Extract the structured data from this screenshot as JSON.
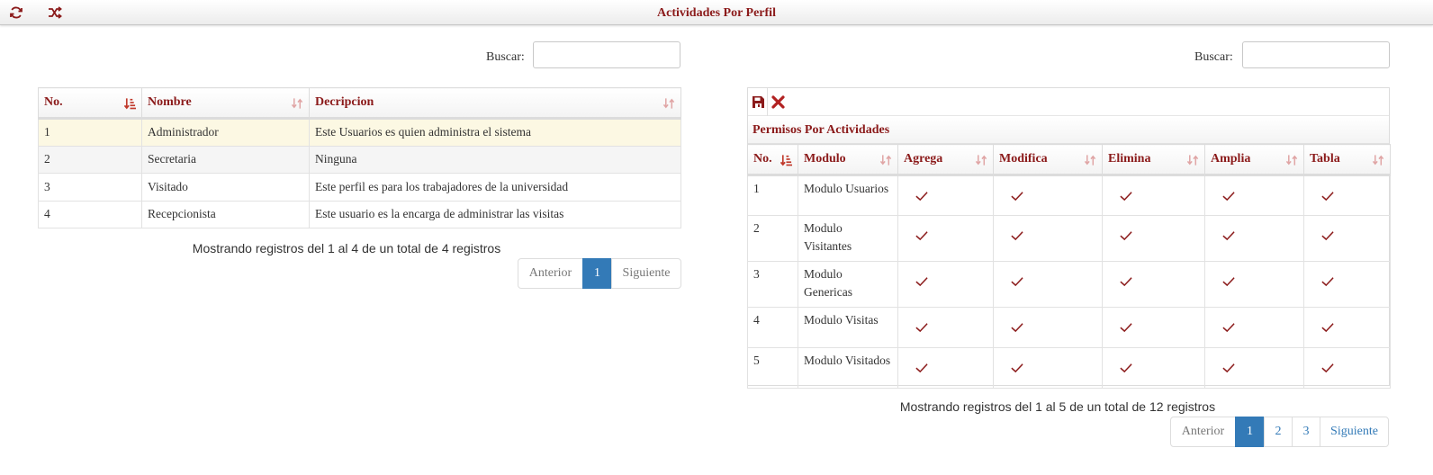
{
  "header": {
    "title": "Actividades Por Perfil",
    "refresh_icon": "refresh-icon",
    "shuffle_icon": "shuffle-icon"
  },
  "colors": {
    "accent": "#8b1a1a",
    "highlight_row": "#fcf8e3",
    "primary": "#337ab7"
  },
  "left": {
    "search_label": "Buscar:",
    "search_value": "",
    "columns": [
      "No.",
      "Nombre",
      "Decripcion"
    ],
    "rows": [
      {
        "no": "1",
        "nombre": "Administrador",
        "descripcion": "Este Usuarios es quien administra el sistema"
      },
      {
        "no": "2",
        "nombre": "Secretaria",
        "descripcion": "Ninguna"
      },
      {
        "no": "3",
        "nombre": "Visitado",
        "descripcion": "Este perfil es para los trabajadores de la universidad"
      },
      {
        "no": "4",
        "nombre": "Recepcionista",
        "descripcion": "Este usuario es la encarga de administrar las visitas"
      }
    ],
    "info": "Mostrando registros del 1 al 4 de un total de 4 registros",
    "pagination": {
      "previous": "Anterior",
      "pages": [
        "1"
      ],
      "current": "1",
      "next": "Siguiente"
    }
  },
  "right": {
    "search_label": "Buscar:",
    "search_value": "",
    "toolbar": {
      "save_icon": "save-icon",
      "delete_icon": "close-icon"
    },
    "caption": "Permisos Por Actividades",
    "columns": [
      "No.",
      "Modulo",
      "Agrega",
      "Modifica",
      "Elimina",
      "Amplia",
      "Tabla"
    ],
    "rows": [
      {
        "no": "1",
        "modulo": "Modulo Usuarios",
        "agrega": true,
        "modifica": true,
        "elimina": true,
        "amplia": true,
        "tabla": true
      },
      {
        "no": "2",
        "modulo": "Modulo Visitantes",
        "agrega": true,
        "modifica": true,
        "elimina": true,
        "amplia": true,
        "tabla": true
      },
      {
        "no": "3",
        "modulo": "Modulo Genericas",
        "agrega": true,
        "modifica": true,
        "elimina": true,
        "amplia": true,
        "tabla": true
      },
      {
        "no": "4",
        "modulo": "Modulo Visitas",
        "agrega": true,
        "modifica": true,
        "elimina": true,
        "amplia": true,
        "tabla": true
      },
      {
        "no": "5",
        "modulo": "Modulo Visitados",
        "agrega": true,
        "modifica": true,
        "elimina": true,
        "amplia": true,
        "tabla": true
      }
    ],
    "info": "Mostrando registros del 1 al 5 de un total de 12 registros",
    "pagination": {
      "previous": "Anterior",
      "pages": [
        "1",
        "2",
        "3"
      ],
      "current": "1",
      "next": "Siguiente"
    }
  }
}
